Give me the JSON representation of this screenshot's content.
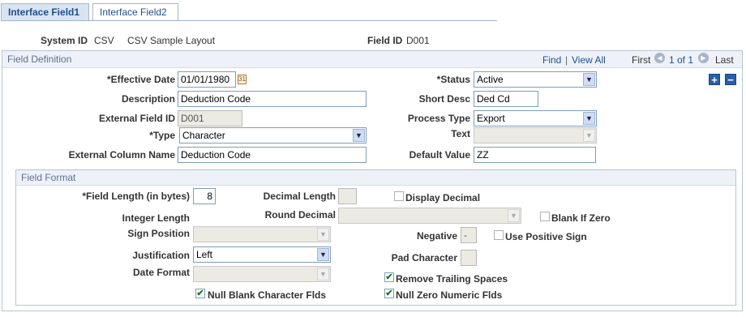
{
  "tabs": [
    {
      "label": "Interface Field1"
    },
    {
      "label": "Interface Field2"
    }
  ],
  "header": {
    "system_id_label": "System ID",
    "system_id_value": "CSV",
    "system_id_desc": "CSV Sample Layout",
    "field_id_label": "Field ID",
    "field_id_value": "D001"
  },
  "field_definition": {
    "title": "Field Definition",
    "nav": {
      "find": "Find",
      "separator": "|",
      "view_all": "View All",
      "first": "First",
      "range": "1 of 1",
      "last": "Last"
    },
    "effective_date_label": "*Effective Date",
    "effective_date_value": "01/01/1980",
    "status_label": "*Status",
    "status_value": "Active",
    "description_label": "Description",
    "description_value": "Deduction Code",
    "short_desc_label": "Short Desc",
    "short_desc_value": "Ded Cd",
    "external_field_id_label": "External Field ID",
    "external_field_id_value": "D001",
    "process_type_label": "Process Type",
    "process_type_value": "Export",
    "type_label": "*Type",
    "type_value": "Character",
    "text_label": "Text",
    "text_value": "",
    "external_column_name_label": "External Column Name",
    "external_column_name_value": "Deduction Code",
    "default_value_label": "Default Value",
    "default_value_value": "ZZ",
    "add_row_glyph": "+",
    "delete_row_glyph": "−"
  },
  "field_format": {
    "title": "Field Format",
    "field_length_label": "*Field Length (in bytes)",
    "field_length_value": "8",
    "decimal_length_label": "Decimal Length",
    "decimal_length_value": "",
    "display_decimal_label": "Display Decimal",
    "display_decimal_checked": false,
    "integer_length_label": "Integer Length",
    "round_decimal_label": "Round Decimal",
    "round_decimal_value": "",
    "blank_if_zero_label": "Blank If Zero",
    "blank_if_zero_checked": false,
    "sign_position_label": "Sign Position",
    "sign_position_value": "",
    "negative_label": "Negative",
    "negative_value": "-",
    "use_positive_sign_label": "Use Positive Sign",
    "use_positive_sign_checked": false,
    "justification_label": "Justification",
    "justification_value": "Left",
    "pad_character_label": "Pad Character",
    "pad_character_value": "",
    "date_format_label": "Date Format",
    "date_format_value": "",
    "remove_trailing_spaces_label": "Remove Trailing Spaces",
    "remove_trailing_spaces_checked": true,
    "null_blank_character_label": "Null Blank Character Flds",
    "null_blank_character_checked": true,
    "null_zero_numeric_label": "Null Zero Numeric Flds",
    "null_zero_numeric_checked": true
  },
  "icons": {
    "dropdown_arrow": "▼",
    "nav_prev": "◀",
    "nav_next": "▶",
    "calendar": "31",
    "checkmark": "✔"
  },
  "colors": {
    "active_tab_bg": "#d8e4f1",
    "link": "#1f4e8c",
    "group_title": "#5f6e90",
    "check_green": "#1a7a1a"
  }
}
